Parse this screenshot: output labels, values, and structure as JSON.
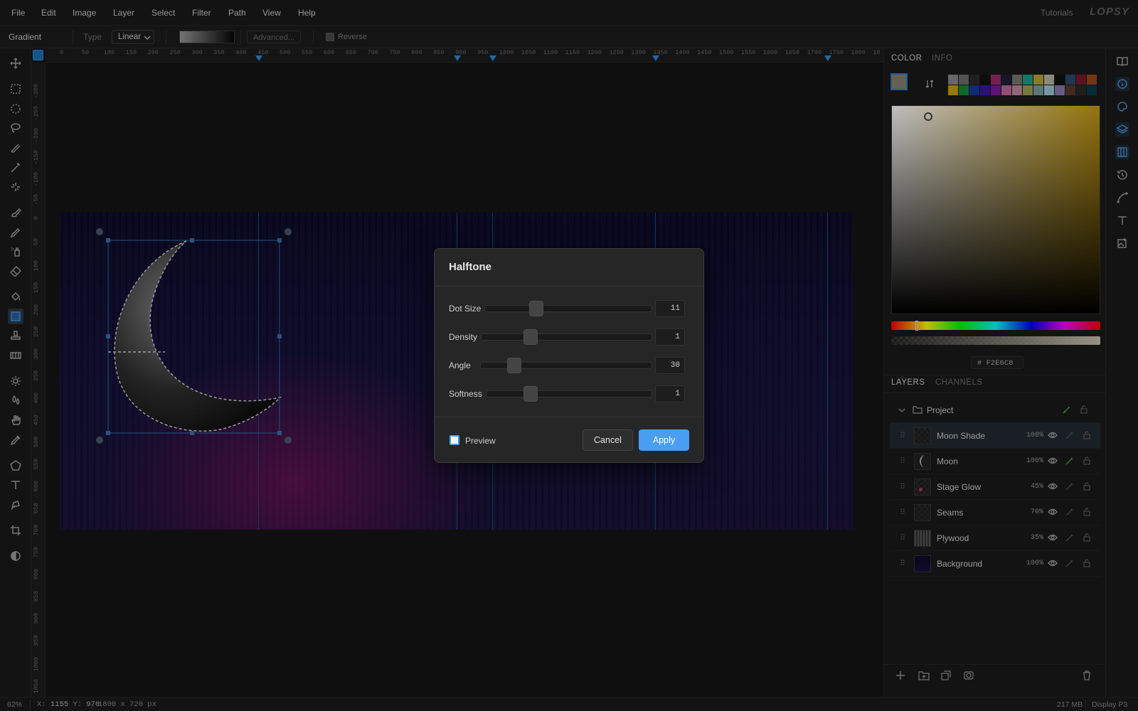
{
  "menubar": {
    "items": [
      "File",
      "Edit",
      "Image",
      "Layer",
      "Select",
      "Filter",
      "Path",
      "View",
      "Help"
    ],
    "tutorials": "Tutorials",
    "logo": "LOPSY"
  },
  "options": {
    "tool_name": "Gradient",
    "type_label": "Type",
    "type_value": "Linear",
    "advanced": "Advanced...",
    "reverse": "Reverse",
    "reverse_checked": false
  },
  "ruler": {
    "top": [
      "0",
      "50",
      "100",
      "150",
      "200",
      "250",
      "300",
      "350",
      "400",
      "450",
      "500",
      "550",
      "600",
      "650",
      "700",
      "750",
      "800",
      "850",
      "900",
      "950",
      "1000",
      "1050",
      "1100",
      "1150",
      "1200",
      "1250",
      "1300",
      "1350",
      "1400",
      "1450",
      "1500",
      "1550",
      "1600",
      "1650",
      "1700",
      "1750",
      "1800",
      "18"
    ],
    "left": [
      "-300",
      "-250",
      "-200",
      "-150",
      "-100",
      "-50",
      "0",
      "50",
      "100",
      "150",
      "200",
      "250",
      "300",
      "350",
      "400",
      "450",
      "500",
      "550",
      "600",
      "650",
      "700",
      "750",
      "800",
      "850",
      "900",
      "950",
      "1000",
      "1050"
    ]
  },
  "panel": {
    "tab_color": "COLOR",
    "tab_info": "INFO",
    "hex_prefix": "#",
    "hex": "F2E6C8",
    "tab_layers": "LAYERS",
    "tab_channels": "CHANNELS",
    "group_name": "Project",
    "layers": [
      {
        "name": "Moon Shade",
        "opacity": "100%"
      },
      {
        "name": "Moon",
        "opacity": "100%"
      },
      {
        "name": "Stage Glow",
        "opacity": "45%"
      },
      {
        "name": "Seams",
        "opacity": "70%"
      },
      {
        "name": "Plywood",
        "opacity": "35%"
      },
      {
        "name": "Background",
        "opacity": "100%"
      }
    ],
    "swatches": [
      "#8a8a8a",
      "#6e6e6e",
      "#2a2a2a",
      "#121212",
      "#9c2a6a",
      "#1e1e3a",
      "#7a7a6e",
      "#1aa08a",
      "#b8a43a",
      "#b8b8a0",
      "#101010",
      "#2a4a6a",
      "#7a1a2a",
      "#9c4a1a",
      "#c8a010",
      "#1a8a3a",
      "#1a3a9c",
      "#3a1a9c",
      "#7a1a9c",
      "#c06a9a",
      "#c08aa0",
      "#a0a05a",
      "#7aa0a0",
      "#a0c8d8",
      "#8a7ab0",
      "#5a3a2a",
      "#2a2a2a",
      "#0a3a4a"
    ]
  },
  "dialog": {
    "title": "Halftone",
    "sliders": [
      {
        "label": "Dot Size",
        "value": "11",
        "level": 0.31
      },
      {
        "label": "Density",
        "value": "1",
        "level": 0.29
      },
      {
        "label": "Angle",
        "value": "30",
        "level": 0.2
      },
      {
        "label": "Softness",
        "value": "1",
        "level": 0.27
      }
    ],
    "preview": "Preview",
    "cancel": "Cancel",
    "apply": "Apply"
  },
  "status": {
    "zoom": "62%",
    "x_label": "X:",
    "x": "1155",
    "y_label": "Y:",
    "y": "970",
    "doc_size": "1800 x 720 px",
    "memory": "217 MB",
    "profile": "Display P3"
  }
}
